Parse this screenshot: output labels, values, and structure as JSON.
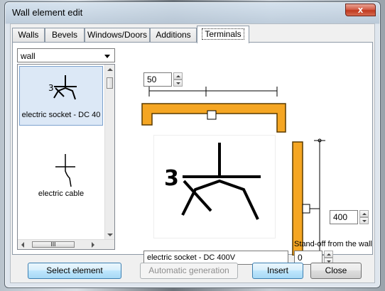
{
  "window": {
    "title": "Wall element edit",
    "close_glyph": "x"
  },
  "tabs": [
    {
      "label": "Walls",
      "active": false
    },
    {
      "label": "Bevels",
      "active": false
    },
    {
      "label": "Windows/Doors",
      "active": false
    },
    {
      "label": "Additions",
      "active": false
    },
    {
      "label": "Terminals",
      "active": true
    }
  ],
  "element_type": {
    "selected": "wall"
  },
  "element_list": {
    "items": [
      {
        "label": "electric socket - DC 40",
        "icon": "electric-socket-symbol",
        "selected": true
      },
      {
        "label": "electric cable",
        "icon": "electric-cable-symbol",
        "selected": false
      }
    ],
    "hscroll_grip": "III"
  },
  "spacing": {
    "value": "50"
  },
  "height": {
    "value": "400"
  },
  "standoff": {
    "label": "Stand-off from the wall",
    "value": "0"
  },
  "element_name": {
    "value": "electric socket - DC 400V"
  },
  "buttons": {
    "select_element": "Select element",
    "automatic_generation": "Automatic generation",
    "insert": "Insert",
    "close": "Close"
  },
  "colors": {
    "wall": "#f5a623",
    "wall_edge": "#5a3a00"
  }
}
